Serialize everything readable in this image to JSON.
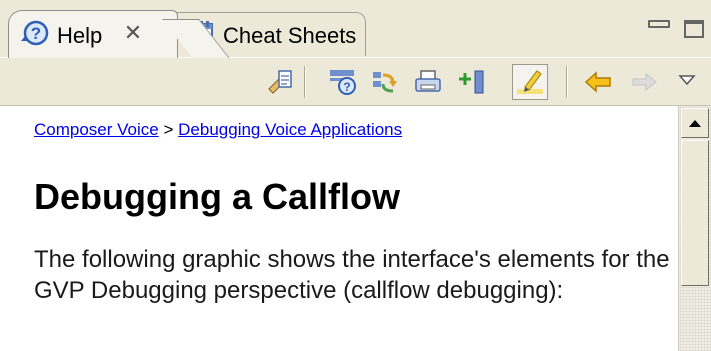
{
  "tabs": {
    "help_label": "Help",
    "help_icon": "help-icon",
    "close_icon": "close-icon",
    "cheat_label": "Cheat Sheets",
    "cheat_icon": "cheat-sheets-icon"
  },
  "window_controls": [
    "minimize-icon",
    "maximize-icon"
  ],
  "toolbar": {
    "buttons": [
      "show-in-all-topics-icon",
      "show-all-topics-icon",
      "sync-with-table-of-contents-icon",
      "print-icon",
      "bookmark-document-icon",
      "highlight-search-terms-icon",
      "back-icon",
      "forward-icon",
      "view-menu-icon"
    ]
  },
  "breadcrumb": {
    "link1": "Composer Voice",
    "separator": ">",
    "link2": "Debugging Voice Applications"
  },
  "page": {
    "title": "Debugging a Callflow",
    "body": "The following graphic shows the interface's elements for the GVP Debugging perspective (callflow debugging):"
  },
  "colors": {
    "chrome": "#ece9d8",
    "link": "#0000ee",
    "back_arrow": "#f0b400"
  }
}
